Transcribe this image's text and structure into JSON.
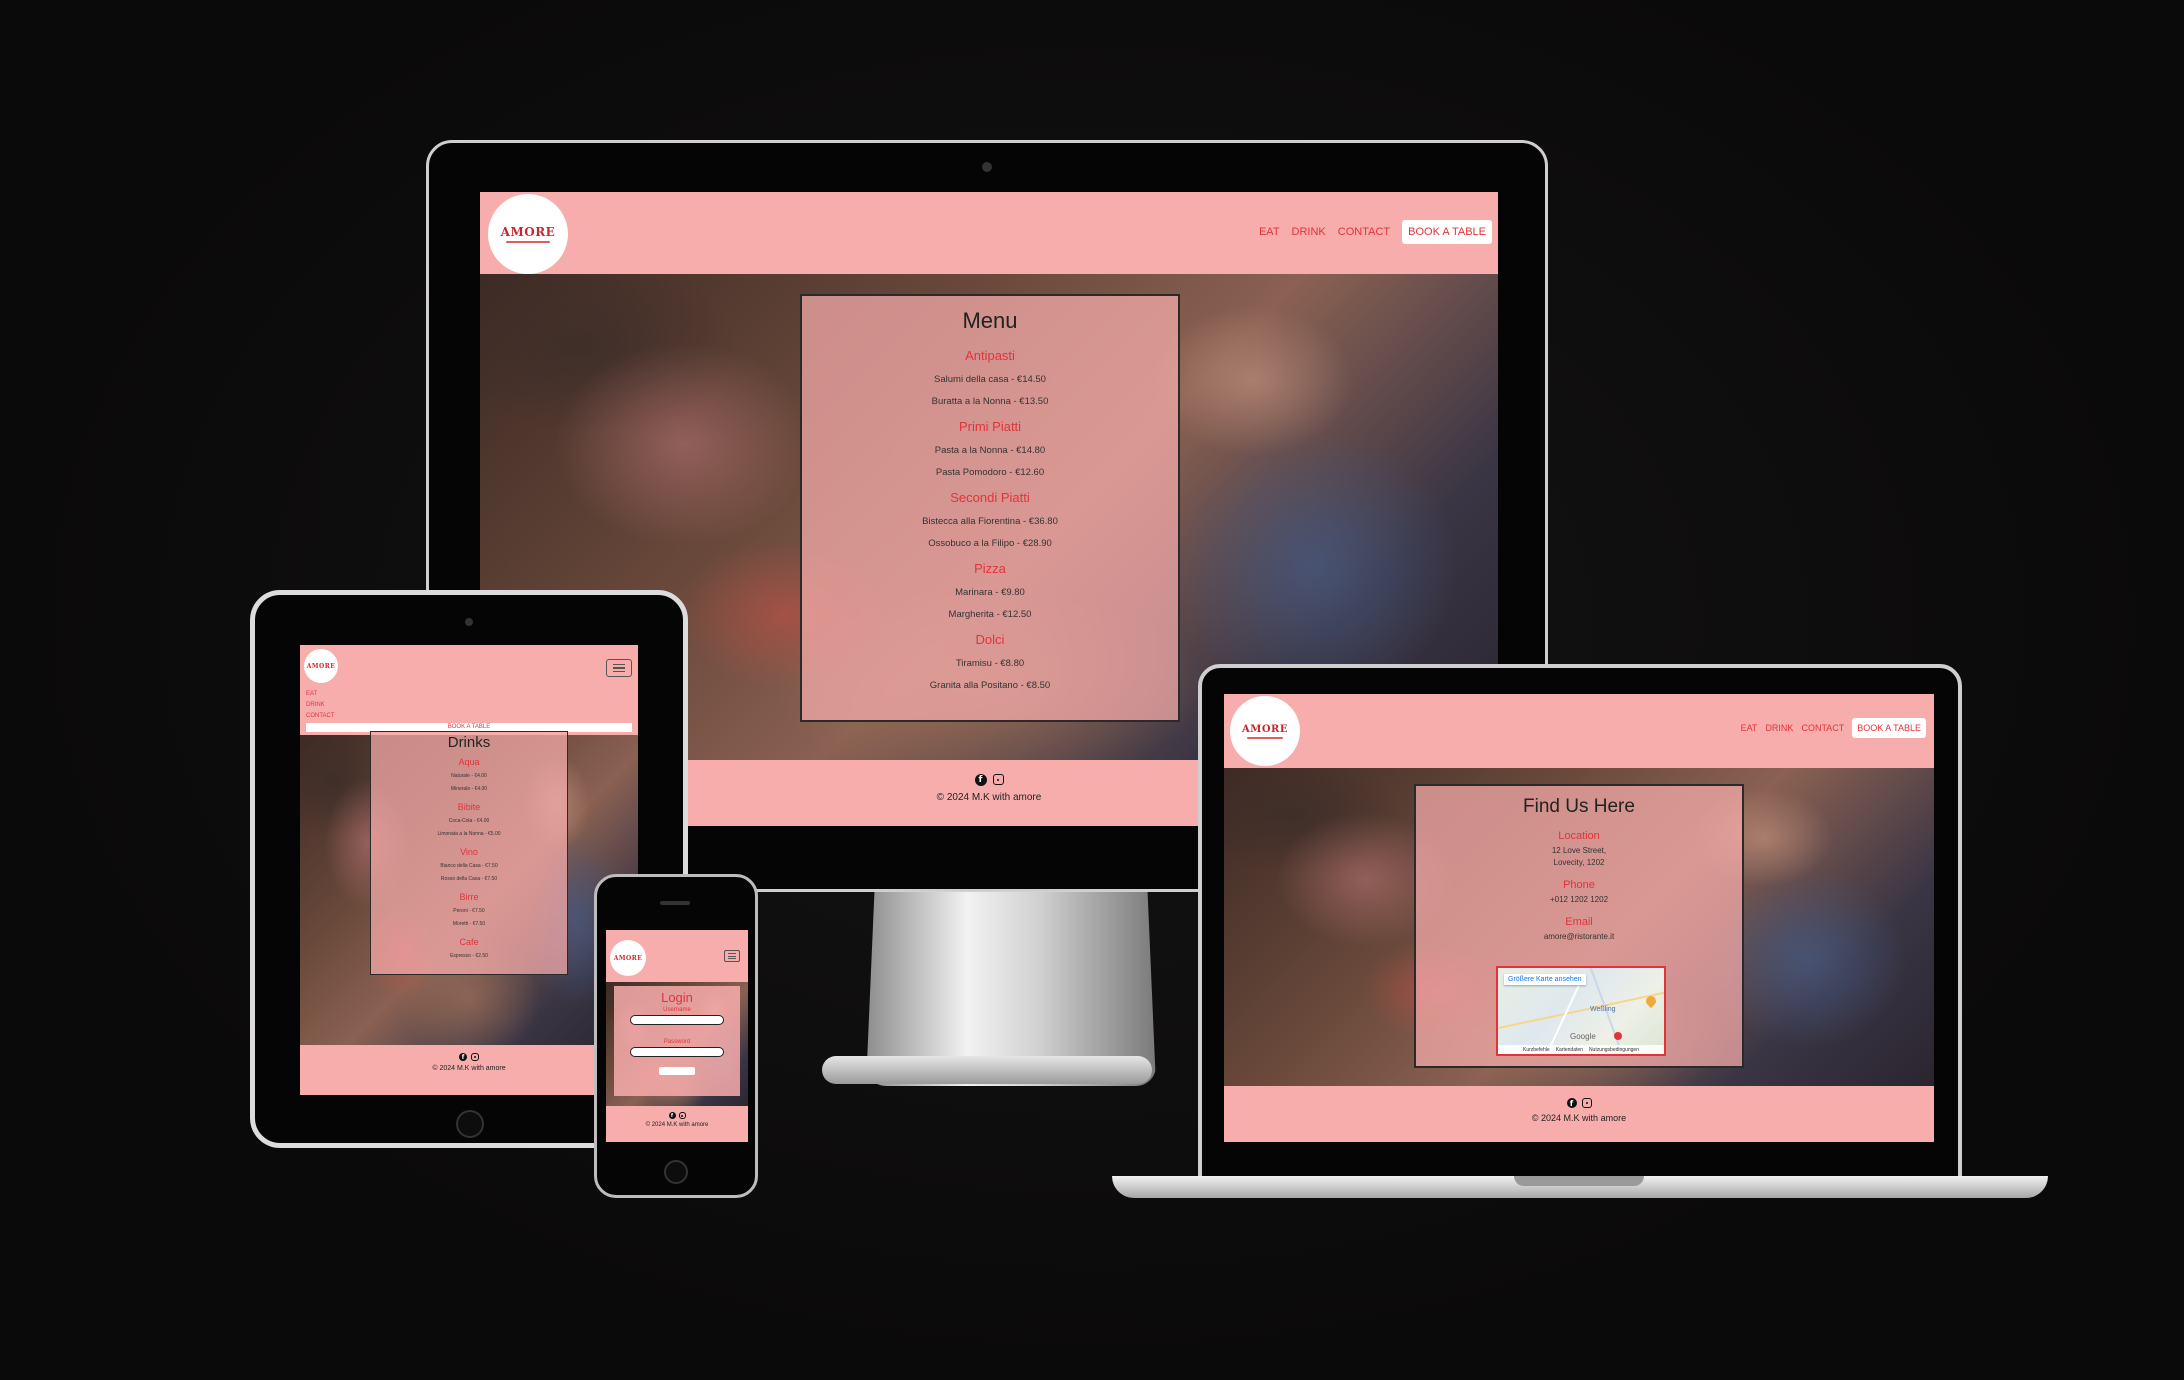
{
  "brand": {
    "name": "AMORE"
  },
  "colors": {
    "brand_pink": "#f8adad",
    "accent_red": "#e0343a",
    "background": "#0b0a0a"
  },
  "nav": {
    "eat": "EAT",
    "drink": "DRINK",
    "contact": "CONTACT",
    "book": "BOOK A TABLE"
  },
  "footer": {
    "copyright": "© 2024 M.K with amore",
    "icons": [
      "facebook-icon",
      "instagram-icon"
    ]
  },
  "desktop": {
    "title": "Menu",
    "sections": [
      {
        "heading": "Antipasti",
        "items": [
          "Salumi della casa - €14.50",
          "Buratta a la Nonna - €13.50"
        ]
      },
      {
        "heading": "Primi Piatti",
        "items": [
          "Pasta a la Nonna - €14.80",
          "Pasta Pomodoro - €12.60"
        ]
      },
      {
        "heading": "Secondi Piatti",
        "items": [
          "Bistecca alla Fiorentina - €36.80",
          "Ossobuco a la Filipo - €28.90"
        ]
      },
      {
        "heading": "Pizza",
        "items": [
          "Marinara - €9.80",
          "Margherita - €12.50"
        ]
      },
      {
        "heading": "Dolci",
        "items": [
          "Tiramisu - €8.80",
          "Granita alla Positano - €8.50"
        ]
      }
    ]
  },
  "tablet": {
    "title": "Drinks",
    "nav_items": [
      "EAT",
      "DRINK",
      "CONTACT"
    ],
    "book": "BOOK A TABLE",
    "sections": [
      {
        "heading": "Aqua",
        "items": [
          "Naturale - €4.00",
          "Minerale - €4.00"
        ]
      },
      {
        "heading": "Bibite",
        "items": [
          "Coca-Cola - €4.00",
          "Limonata a la Nonna - €5.00"
        ]
      },
      {
        "heading": "Vino",
        "items": [
          "Bianco della Casa - €7.50",
          "Rosso della Casa - €7.50"
        ]
      },
      {
        "heading": "Birre",
        "items": [
          "Peroni - €7.50",
          "Moretti - €7.50"
        ]
      },
      {
        "heading": "Cafe",
        "items": [
          "Espresso - €2.50"
        ]
      }
    ]
  },
  "phone": {
    "title": "Login",
    "username_label": "Username",
    "password_label": "Password"
  },
  "laptop": {
    "title": "Find Us Here",
    "location_heading": "Location",
    "address_line1": "12 Love Street,",
    "address_line2": "Lovecity, 1202",
    "phone_heading": "Phone",
    "phone_value": "+012 1202 1202",
    "email_heading": "Email",
    "email_value": "amore@ristorante.it",
    "map": {
      "enlarge": "Größere Karte ansehen",
      "place": "Weßling",
      "google": "Google",
      "footer_items": [
        "Kurzbefehle",
        "Kartendaten",
        "Nutzungsbedingungen"
      ]
    }
  }
}
